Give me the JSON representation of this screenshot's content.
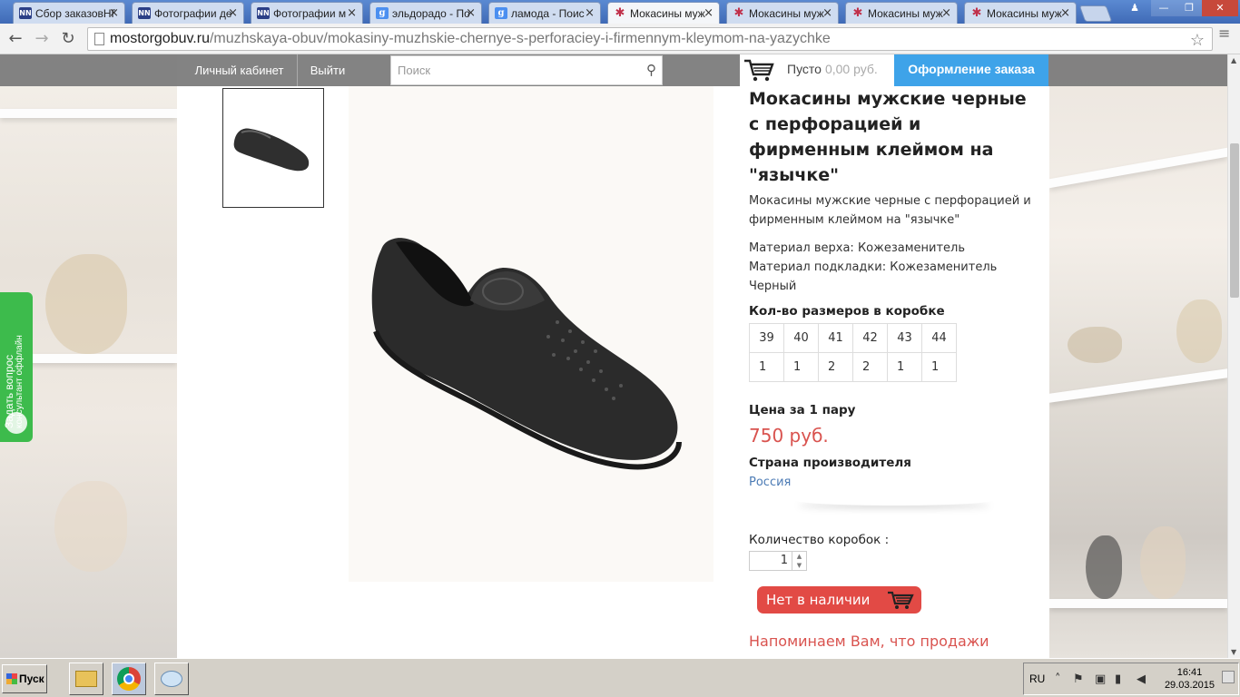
{
  "browser": {
    "tabs": [
      {
        "label": "Сбор заказовНГ",
        "favicon": "NN",
        "active": false
      },
      {
        "label": "Фотографии де",
        "favicon": "NN",
        "active": false
      },
      {
        "label": "Фотографии м",
        "favicon": "NN",
        "active": false
      },
      {
        "label": "эльдорадо - По",
        "favicon": "g",
        "active": false
      },
      {
        "label": "ламода - Поис",
        "favicon": "g",
        "active": false
      },
      {
        "label": "Мокасины муж",
        "favicon": "star",
        "active": true
      },
      {
        "label": "Мокасины муж",
        "favicon": "star",
        "active": false
      },
      {
        "label": "Мокасины муж",
        "favicon": "star",
        "active": false
      },
      {
        "label": "Мокасины муж",
        "favicon": "star",
        "active": false
      }
    ],
    "url_host": "mostorgobuv.ru",
    "url_path": "/muzhskaya-obuv/mokasiny-muzhskie-chernye-s-perforaciey-i-firmennym-kleymom-na-yazychke"
  },
  "site": {
    "nav": {
      "account": "Личный кабинет",
      "logout": "Выйти"
    },
    "search_placeholder": "Поиск",
    "cart": {
      "status": "Пусто",
      "sum": "0,00 руб."
    },
    "checkout": "Оформление заказа"
  },
  "product": {
    "title": "Мокасины мужские черные с перфорацией и фирменным клеймом на \"язычке\"",
    "subtitle": "Мокасины мужские черные с перфорацией и фирменным клеймом на \"язычке\"",
    "attrs": [
      "Материал верха: Кожезаменитель",
      "Материал подкладки: Кожезаменитель",
      "Черный"
    ],
    "sizes_label": "Кол-во размеров в коробке",
    "sizes": [
      "39",
      "40",
      "41",
      "42",
      "43",
      "44"
    ],
    "quantities": [
      "1",
      "1",
      "2",
      "2",
      "1",
      "1"
    ],
    "price_label": "Цена за 1 пару",
    "price": "750 руб.",
    "country_label": "Страна производителя",
    "country": "Россия",
    "qty_label": "Количество коробок :",
    "qty_value": "1",
    "stock_button": "Нет в наличии",
    "notice": "Напоминаем Вам, что продажи осуществляются оптом, минимум один короб."
  },
  "widget": {
    "line1": "Задать вопрос",
    "line2": "консультант оффлайн"
  },
  "taskbar": {
    "start": "Пуск",
    "lang": "RU",
    "time": "16:41",
    "date": "29.03.2015"
  },
  "colors": {
    "accent_blue": "#3ea3e9",
    "price_red": "#d9534f",
    "link_blue": "#4c7bb5",
    "widget_green": "#3dbb4c"
  }
}
